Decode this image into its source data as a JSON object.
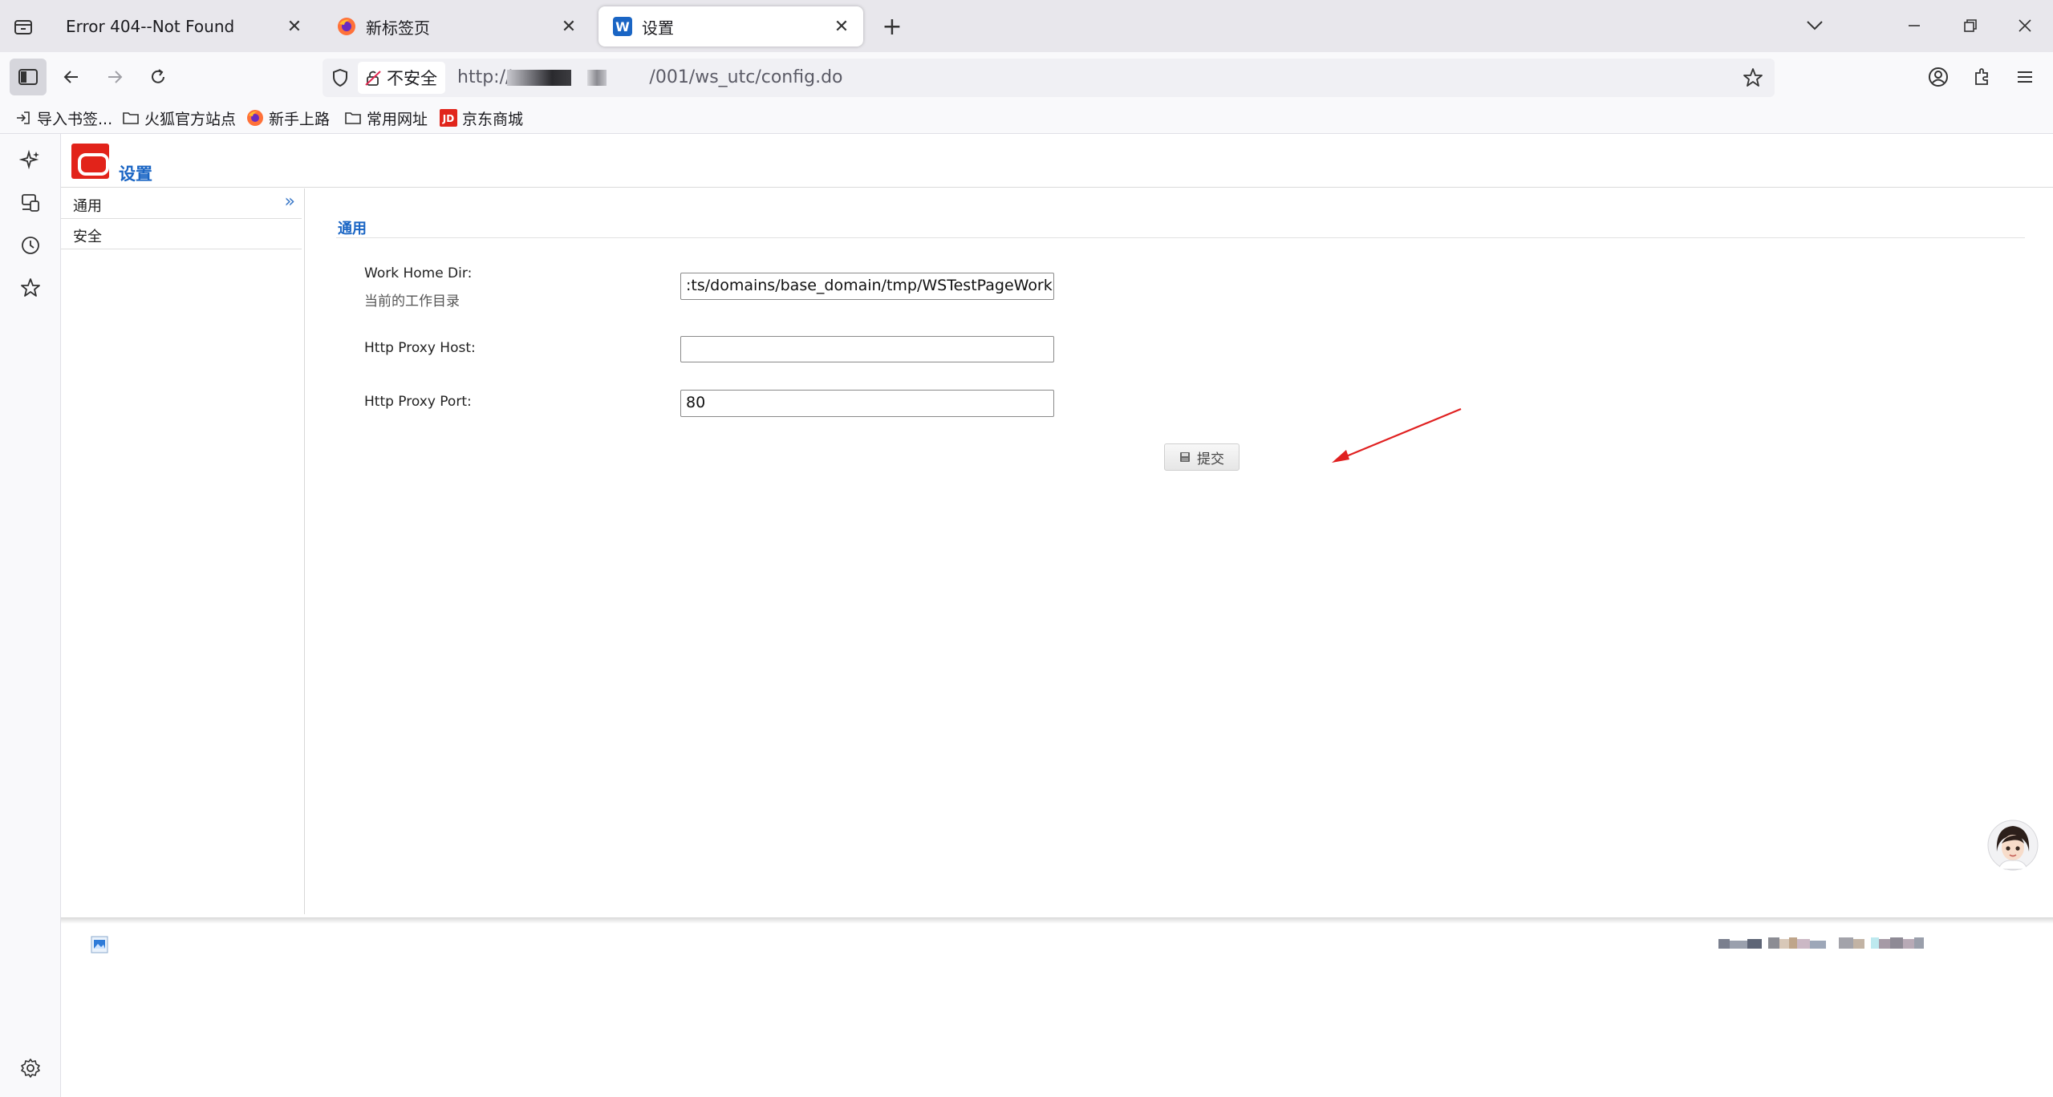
{
  "browser": {
    "tabs": [
      {
        "title": "Error 404--Not Found",
        "active": false
      },
      {
        "title": "新标签页",
        "active": false
      },
      {
        "title": "设置",
        "active": true
      }
    ],
    "new_tab_symbol": "+",
    "url_security_label": "不安全",
    "url_prefix": "http://",
    "url_suffix": "/001/ws_utc/config.do",
    "bookmarks": [
      {
        "label": "导入书签...",
        "icon": "import-icon"
      },
      {
        "label": "火狐官方站点",
        "icon": "folder-icon"
      },
      {
        "label": "新手上路",
        "icon": "firefox-icon"
      },
      {
        "label": "常用网址",
        "icon": "folder-icon"
      },
      {
        "label": "京东商城",
        "icon": "jd-icon"
      }
    ],
    "colors": {
      "accent": "#1a65c4",
      "logo_red": "#e2231a",
      "annotation_arrow": "#e02020"
    }
  },
  "page": {
    "title": "设置",
    "nav": [
      {
        "label": "通用",
        "chevron": "»"
      },
      {
        "label": "安全"
      }
    ],
    "section_title": "通用",
    "fields": [
      {
        "label": "Work Home Dir:",
        "sublabel": "当前的工作目录",
        "value": ":ts/domains/base_domain/tmp/WSTestPageWorkDir"
      },
      {
        "label": "Http Proxy Host:",
        "value": ""
      },
      {
        "label": "Http Proxy Port:",
        "value": "80"
      }
    ],
    "submit_label": "提交"
  }
}
